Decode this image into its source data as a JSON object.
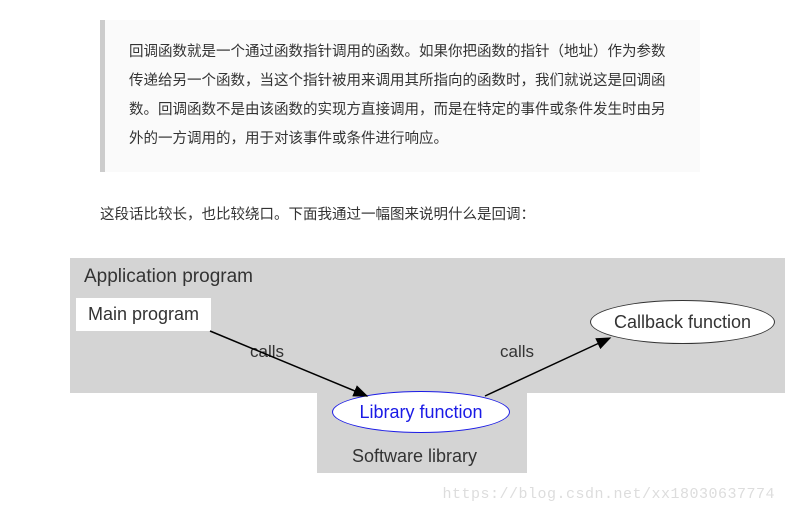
{
  "quote": {
    "text": "回调函数就是一个通过函数指针调用的函数。如果你把函数的指针（地址）作为参数传递给另一个函数，当这个指针被用来调用其所指向的函数时，我们就说这是回调函数。回调函数不是由该函数的实现方直接调用，而是在特定的事件或条件发生时由另外的一方调用的，用于对该事件或条件进行响应。"
  },
  "description": "这段话比较长，也比较绕口。下面我通过一幅图来说明什么是回调：",
  "diagram": {
    "app_program_label": "Application program",
    "main_program_label": "Main program",
    "callback_label": "Callback function",
    "calls_label_1": "calls",
    "calls_label_2": "calls",
    "library_function_label": "Library function",
    "software_library_label": "Software library"
  },
  "watermark": "https://blog.csdn.net/xx18030637774"
}
